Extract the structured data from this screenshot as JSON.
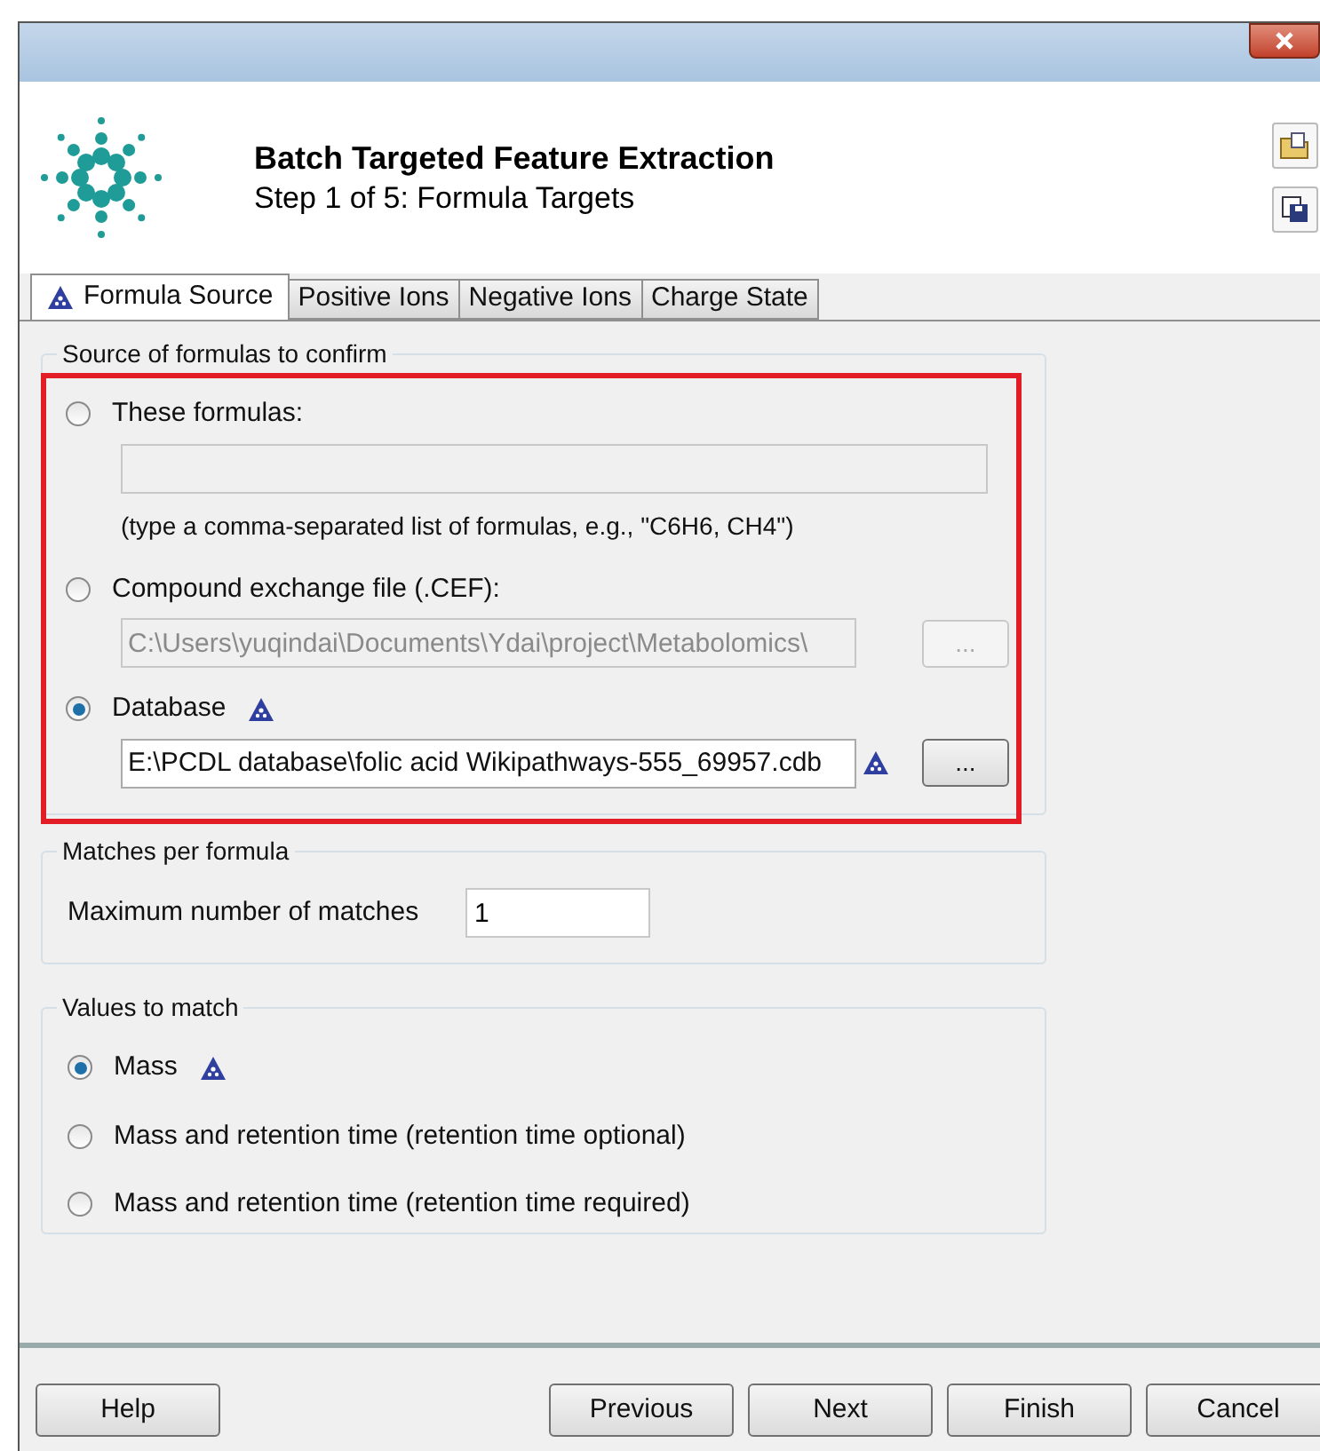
{
  "header": {
    "title": "Batch Targeted Feature Extraction",
    "subtitle": "Step 1 of 5:  Formula Targets"
  },
  "tabs": [
    {
      "label": "Formula Source",
      "selected": true,
      "flagged": true
    },
    {
      "label": "Positive Ions",
      "selected": false,
      "flagged": false
    },
    {
      "label": "Negative Ions",
      "selected": false,
      "flagged": false
    },
    {
      "label": "Charge State",
      "selected": false,
      "flagged": false
    }
  ],
  "source_group": {
    "legend": "Source of formulas to confirm",
    "options": [
      {
        "label": "These formulas:",
        "selected": false,
        "flagged": false,
        "field": {
          "disabled": true
        },
        "hint": "(type a comma-separated list of formulas, e.g., \"C6H6, CH4\")"
      },
      {
        "label": "Compound exchange file (.CEF):",
        "selected": false,
        "flagged": false,
        "field": {
          "value": "C:\\Users\\yuqindai\\Documents\\Ydai\\project\\Metabolomics\\",
          "disabled": true
        },
        "browse": {
          "label": "...",
          "disabled": true
        }
      },
      {
        "label": "Database",
        "selected": true,
        "flagged": true,
        "field": {
          "value": "E:\\PCDL database\\folic acid Wikipathways-555_69957.cdb",
          "disabled": false,
          "flagged": true
        },
        "browse": {
          "label": "...",
          "disabled": false
        }
      }
    ]
  },
  "matches_group": {
    "legend": "Matches per formula",
    "label": "Maximum number of matches",
    "value": "1"
  },
  "values_group": {
    "legend": "Values to match",
    "options": [
      {
        "label": "Mass",
        "selected": true,
        "flagged": true
      },
      {
        "label": "Mass and retention time (retention time optional)",
        "selected": false,
        "flagged": false
      },
      {
        "label": "Mass and retention time (retention time required)",
        "selected": false,
        "flagged": false
      }
    ]
  },
  "buttons": [
    {
      "label": "Help"
    },
    {
      "label": "Previous"
    },
    {
      "label": "Next"
    },
    {
      "label": "Finish"
    },
    {
      "label": "Cancel"
    }
  ]
}
